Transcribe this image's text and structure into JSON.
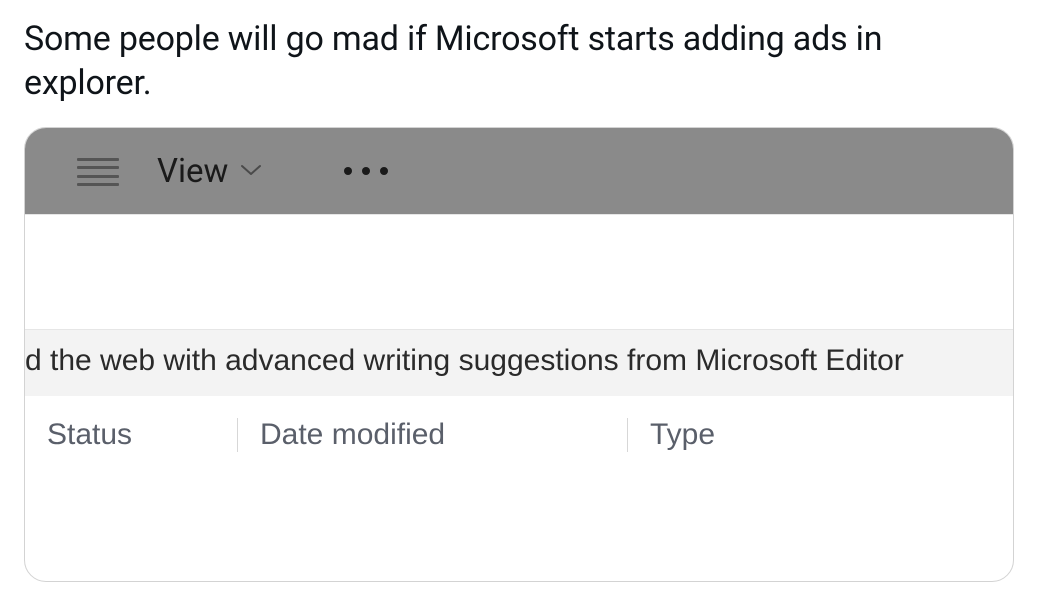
{
  "tweet": {
    "text": "Some people will go mad if Microsoft starts adding ads in explorer."
  },
  "toolbar": {
    "view_label": "View"
  },
  "ad_banner_text": "d the web with advanced writing suggestions from Microsoft Editor",
  "columns": {
    "status": "Status",
    "date_modified": "Date modified",
    "type": "Type"
  }
}
